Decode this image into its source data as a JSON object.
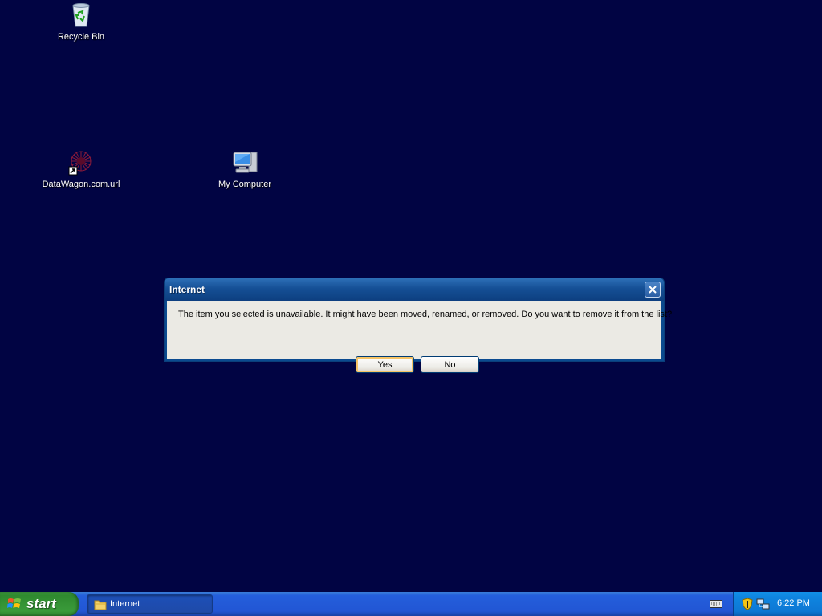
{
  "desktop": {
    "background_color": "#010443",
    "icons": [
      {
        "label": "Recycle Bin",
        "icon": "recycle-bin-icon"
      },
      {
        "label": "DataWagon.com.url",
        "icon": "internet-shortcut-icon"
      },
      {
        "label": "My Computer",
        "icon": "my-computer-icon"
      }
    ]
  },
  "dialog": {
    "title": "Internet",
    "message": "The item you selected is unavailable.  It might have been moved, renamed, or removed.  Do you want to remove it from the list?",
    "buttons": {
      "yes": "Yes",
      "no": "No"
    },
    "default_button": "Yes"
  },
  "taskbar": {
    "start_label": "start",
    "tasks": [
      {
        "label": "Internet",
        "icon": "folder-icon",
        "active": true
      }
    ],
    "tray": {
      "clock": "6:22 PM",
      "icons": [
        "security-shield-icon",
        "network-icon"
      ]
    },
    "keyboard_icon": "keyboard-icon"
  }
}
